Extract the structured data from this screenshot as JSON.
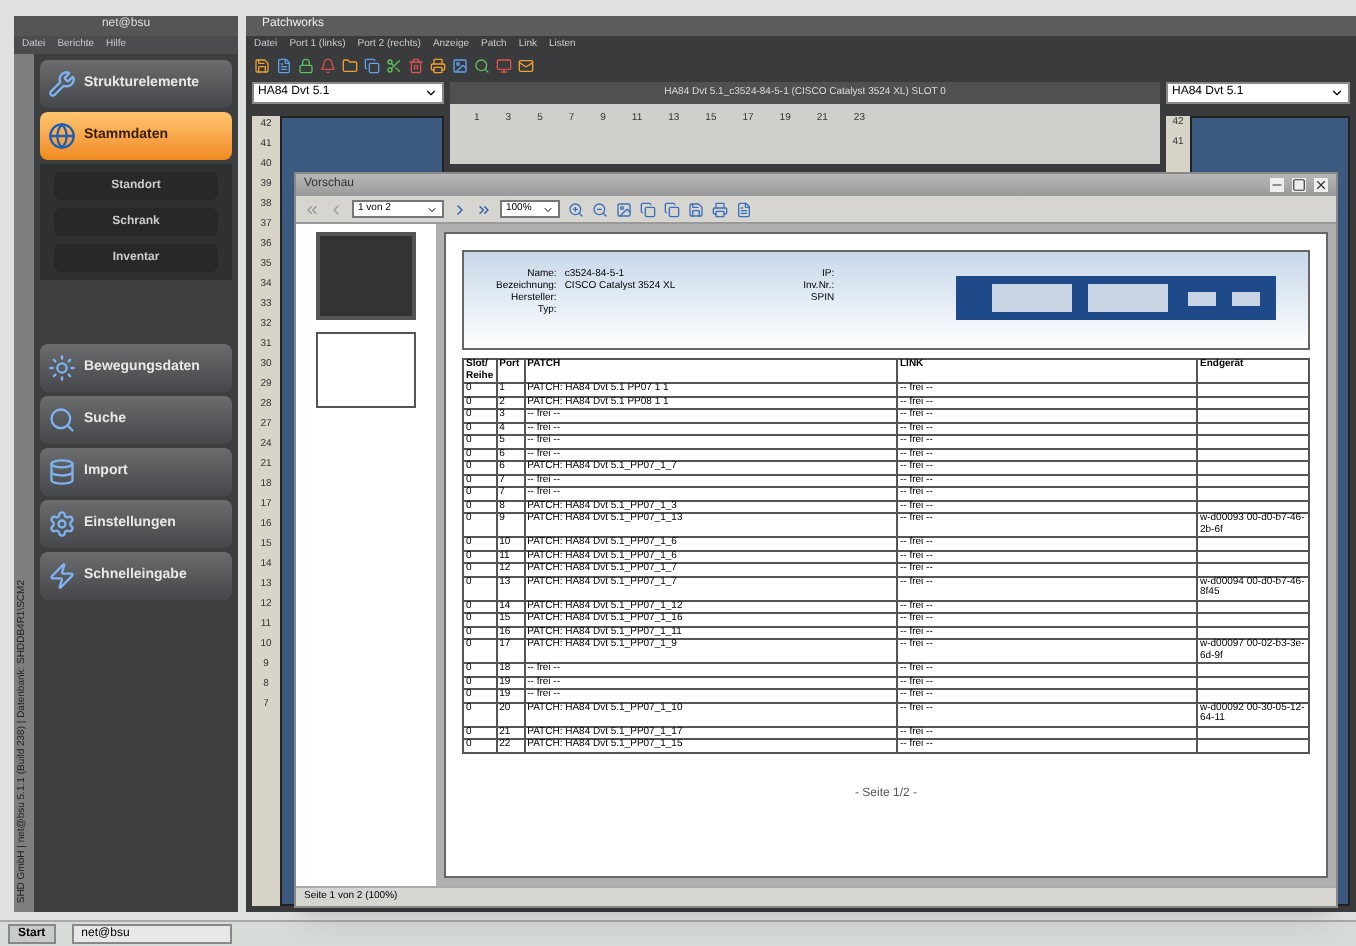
{
  "left_window": {
    "title": "net@bsu",
    "menu": [
      "Datei",
      "Berichte",
      "Hilfe"
    ],
    "side_caption": "SHD GmbH | net@bsu 5.1.1 (Build 238) | Datenbank: SHDDB4R1\\SCM2",
    "nav": [
      {
        "label": "Strukturelemente",
        "selected": false
      },
      {
        "label": "Stammdaten",
        "selected": true,
        "children": [
          {
            "label": "Standort",
            "selected": false
          },
          {
            "label": "Schrank",
            "selected": false
          },
          {
            "label": "Inventar",
            "selected": false
          }
        ]
      },
      {
        "label": "Bewegungsdaten",
        "selected": false
      },
      {
        "label": "Suche",
        "selected": false
      },
      {
        "label": "Import",
        "selected": false
      },
      {
        "label": "Einstellungen",
        "selected": false
      },
      {
        "label": "Schnelleingabe",
        "selected": false
      }
    ]
  },
  "patchworks": {
    "title": "Patchworks",
    "menu": [
      "Datei",
      "Port 1 (links)",
      "Port 2 (rechts)",
      "Anzeige",
      "Patch",
      "Link",
      "Listen"
    ],
    "left_panel": {
      "combo": "HA84 Dvt 5.1",
      "rows": [
        "42",
        "41",
        "40",
        "39",
        "38",
        "37",
        "36",
        "35",
        "34",
        "33",
        "32",
        "31",
        "30",
        "29",
        "28",
        "27",
        "24",
        "21",
        "18",
        "17",
        "16",
        "15",
        "14",
        "13",
        "12",
        "11",
        "10",
        "9",
        "8",
        "7"
      ]
    },
    "center_panel": {
      "title": "HA84 Dvt 5.1_c3524-84-5-1 (CISCO Catalyst 3524 XL) SLOT 0",
      "ports": [
        "1",
        "3",
        "5",
        "7",
        "9",
        "11",
        "13",
        "15",
        "17",
        "19",
        "21",
        "23"
      ]
    },
    "right_panel": {
      "combo": "HA84 Dvt 5.1",
      "rows": [
        "42",
        "41"
      ]
    }
  },
  "preview": {
    "title": "Vorschau",
    "page_select": "1 von 2",
    "zoom": "100%",
    "header_left": [
      {
        "label": "Name:",
        "value": "c3524-84-5-1"
      },
      {
        "label": "Bezeichnung:",
        "value": "CISCO Catalyst 3524 XL"
      },
      {
        "label": "Hersteller:"
      },
      {
        "label": "Typ:"
      }
    ],
    "header_right": [
      "IP:",
      "Inv.Nr.:",
      "SPIN"
    ],
    "columns": [
      "Slot/ Reihe",
      "Port",
      "PATCH",
      "LINK",
      "Endgerät"
    ],
    "rows": [
      [
        "0",
        "1",
        "PATCH: HA84 Dvt 5.1 PP07 1 1",
        "-- frei --",
        ""
      ],
      [
        "0",
        "2",
        "PATCH: HA84 Dvt 5.1 PP08 1 1",
        "-- frei --",
        ""
      ],
      [
        "0",
        "3",
        "-- frei --",
        "-- frei --",
        ""
      ],
      [
        "0",
        "4",
        "-- frei --",
        "-- frei --",
        ""
      ],
      [
        "0",
        "5",
        "-- frei --",
        "-- frei --",
        ""
      ],
      [
        "0",
        "6",
        "-- frei --",
        "-- frei --",
        ""
      ],
      [
        "0",
        "6",
        "PATCH: HA84 Dvt 5.1_PP07_1_7",
        "-- frei --",
        ""
      ],
      [
        "0",
        "7",
        "-- frei --",
        "-- frei --",
        ""
      ],
      [
        "0",
        "7",
        "-- frei --",
        "-- frei --",
        ""
      ],
      [
        "0",
        "8",
        "PATCH: HA84 Dvt 5.1_PP07_1_3",
        "-- frei --",
        ""
      ],
      [
        "0",
        "9",
        "PATCH: HA84 Dvt 5.1_PP07_1_13",
        "-- frei --",
        "w-d00093 00-d0-b7-46-2b-6f"
      ],
      [
        "0",
        "10",
        "PATCH: HA84 Dvt 5.1_PP07_1_6",
        "-- frei --",
        ""
      ],
      [
        "0",
        "11",
        "PATCH: HA84 Dvt 5.1_PP07_1_6",
        "-- frei --",
        ""
      ],
      [
        "0",
        "12",
        "PATCH: HA84 Dvt 5.1_PP07_1_7",
        "-- frei --",
        ""
      ],
      [
        "0",
        "13",
        "PATCH: HA84 Dvt 5.1_PP07_1_7",
        "-- frei --",
        "w-d00094 00-d0-b7-46-8f45"
      ],
      [
        "0",
        "14",
        "PATCH: HA84 Dvt 5.1_PP07_1_12",
        "-- frei --",
        ""
      ],
      [
        "0",
        "15",
        "PATCH: HA84 Dvt 5.1_PP07_1_16",
        "-- frei --",
        ""
      ],
      [
        "0",
        "16",
        "PATCH: HA84 Dvt 5.1_PP07_1_11",
        "-- frei --",
        ""
      ],
      [
        "0",
        "17",
        "PATCH: HA84 Dvt 5.1_PP07_1_9",
        "-- frei --",
        "w-d00097 00-02-b3-3e-6d-9f"
      ],
      [
        "0",
        "18",
        "-- frei --",
        "-- frei --",
        ""
      ],
      [
        "0",
        "19",
        "-- frei --",
        "-- frei --",
        ""
      ],
      [
        "0",
        "19",
        "-- frei --",
        "-- frei --",
        ""
      ],
      [
        "0",
        "20",
        "PATCH: HA84 Dvt 5.1_PP07_1_10",
        "-- frei --",
        "w-d00092 00-30-05-12-64-11"
      ],
      [
        "0",
        "21",
        "PATCH: HA84 Dvt 5.1_PP07_1_17",
        "-- frei --",
        ""
      ],
      [
        "0",
        "22",
        "PATCH: HA84 Dvt 5.1_PP07_1_15",
        "-- frei --",
        ""
      ]
    ],
    "footer": "- Seite 1/2 -",
    "status": "Seite 1 von 2 (100%)"
  },
  "taskbar": {
    "start": "Start",
    "tasks": [
      "net@bsu"
    ]
  }
}
